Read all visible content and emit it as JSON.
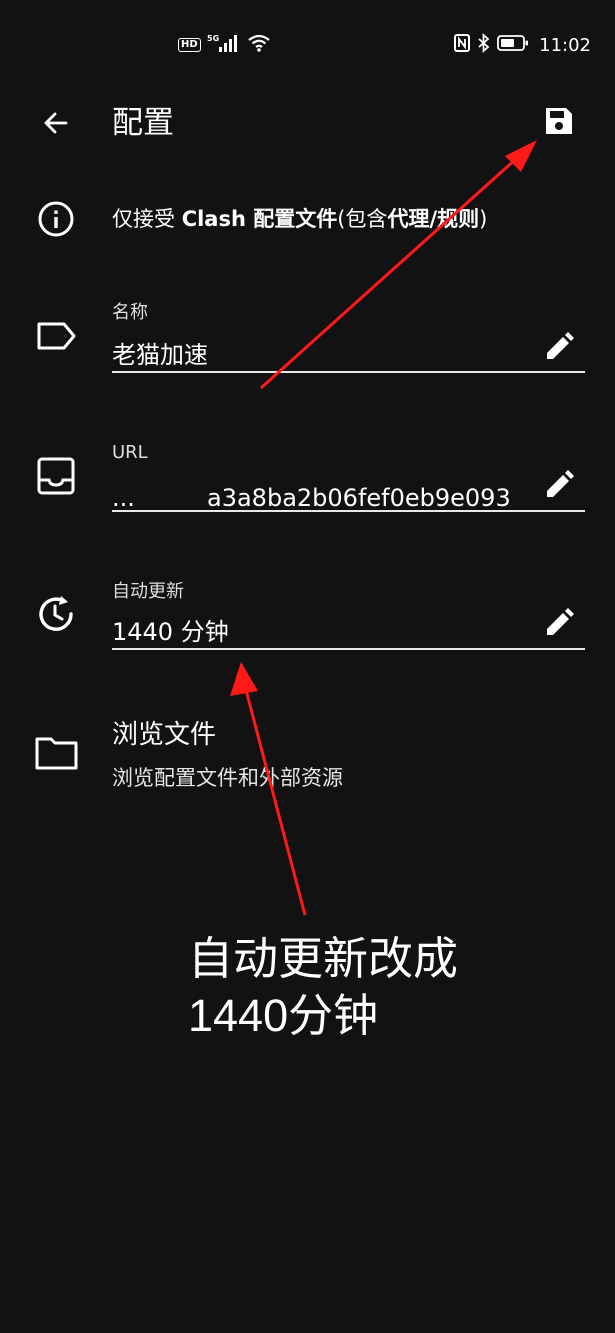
{
  "status_bar": {
    "hd_label": "HD",
    "network_label": "5G",
    "time": "11:02"
  },
  "top_bar": {
    "title": "配置",
    "back_icon": "arrow-left-icon",
    "save_icon": "save-icon"
  },
  "info": {
    "icon": "info-icon",
    "prefix": "仅接受 ",
    "bold1": "Clash 配置文件",
    "mid": "(包含",
    "bold2": "代理",
    "slash": "/",
    "bold3": "规则",
    "suffix": ")"
  },
  "fields": {
    "name": {
      "label": "名称",
      "value": "老猫加速",
      "icon": "label-tag-icon"
    },
    "url": {
      "label": "URL",
      "ellipsis": "...",
      "value": "a3a8ba2b06fef0eb9e093",
      "icon": "inbox-icon"
    },
    "auto_update": {
      "label": "自动更新",
      "value": "1440 分钟",
      "icon": "history-icon"
    }
  },
  "browse": {
    "title": "浏览文件",
    "subtitle": "浏览配置文件和外部资源",
    "icon": "folder-icon"
  },
  "annotation": {
    "line1": "自动更新改成",
    "line2": "1440分钟",
    "arrow_color": "#ff1a1a"
  },
  "colors": {
    "background": "#121212",
    "foreground": "#ffffff",
    "underline": "#e8e8e8"
  }
}
